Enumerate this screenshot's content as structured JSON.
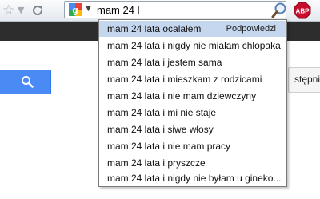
{
  "toolbar": {
    "star_icon": "star-icon",
    "dropdown_icon": "dropdown-arrow-icon",
    "reload_icon": "reload-icon",
    "search_engine_icon": "google-search-engine-icon",
    "search_query": "mam 24 l",
    "magnifier_icon": "magnifier-icon",
    "addon_label": "ABP"
  },
  "suggestions": {
    "header_hint": "Podpowiedzi",
    "items": [
      "mam 24 lata ocalałem",
      "mam 24 lata i nigdy nie miałam chłopaka",
      "mam 24 lata i jestem sama",
      "mam 24 lata i mieszkam z rodzicami",
      "mam 24 lata i nie mam dziewczyny",
      "mam 24 lata i mi nie staje",
      "mam 24 lata i siwe włosy",
      "mam 24 lata i nie mam pracy",
      "mam 24 lata i pryszcze",
      "mam 24 lata i nigdy nie byłam u gineko..."
    ]
  },
  "page": {
    "right_partial_text": "stępni",
    "search_button_icon": "search-icon"
  },
  "colors": {
    "accent_blue": "#4a8af4",
    "selection": "#c5d7ef",
    "dark_bar": "#2d2d2d",
    "abp_red": "#c70d2c"
  }
}
